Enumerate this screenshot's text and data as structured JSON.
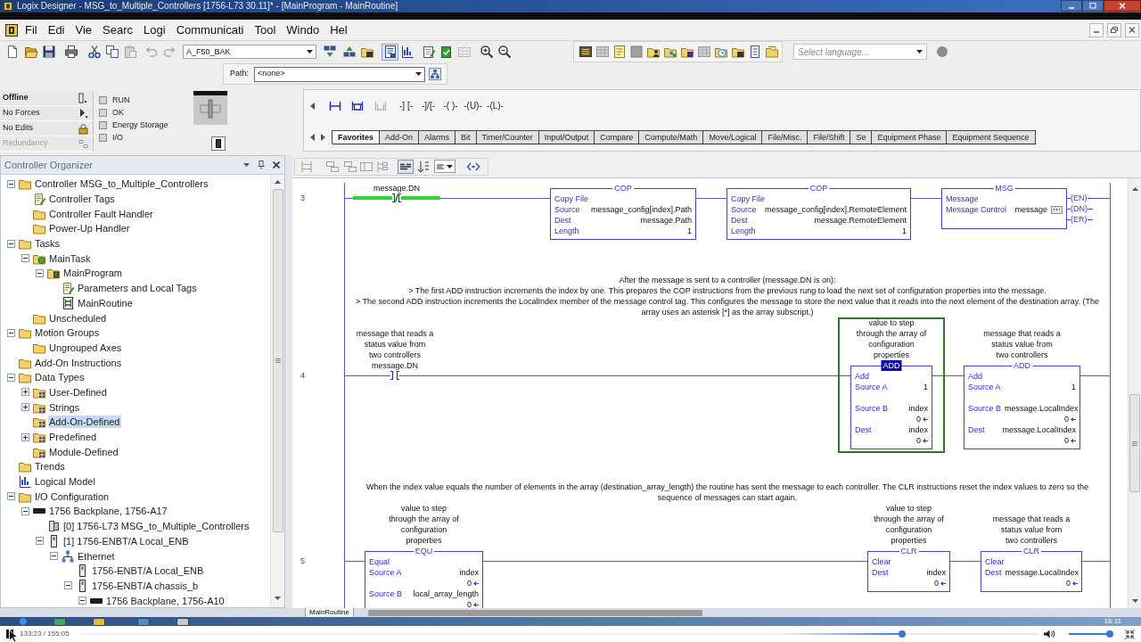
{
  "window": {
    "title": "Logix Designer - MSG_to_Multiple_Controllers [1756-L73 30.11]* - [MainProgram - MainRoutine]"
  },
  "menu": [
    "Fil",
    "Edi",
    "Vie",
    "Searc",
    "Logi",
    "Communicati",
    "Tool",
    "Windo",
    "Hel"
  ],
  "toolbar": {
    "recent_item": "A_F50_BAK",
    "language": {
      "placeholder": "Select language..."
    }
  },
  "path_bar": {
    "label": "Path:",
    "value": "<none>"
  },
  "controller_status": {
    "modes": [
      {
        "label": "Offline",
        "emphasized": true,
        "disabled": false
      },
      {
        "label": "No Forces",
        "emphasized": false,
        "disabled": false
      },
      {
        "label": "No Edits",
        "emphasized": false,
        "disabled": false
      },
      {
        "label": "Redundancy",
        "emphasized": false,
        "disabled": true
      }
    ],
    "indicators": [
      {
        "label": "RUN",
        "on": false
      },
      {
        "label": "OK",
        "on": false
      },
      {
        "label": "Energy Storage",
        "on": false
      },
      {
        "label": "I/O",
        "on": false
      }
    ]
  },
  "instruction_palette": {
    "symbols": [
      "-] [-",
      "-]/[-",
      "-( )-",
      "-(U)-",
      "-(L)-"
    ],
    "tabs": [
      {
        "label": "Favorites",
        "selected": true
      },
      {
        "label": "Add-On",
        "selected": false
      },
      {
        "label": "Alarms",
        "selected": false
      },
      {
        "label": "Bit",
        "selected": false
      },
      {
        "label": "Timer/Counter",
        "selected": false
      },
      {
        "label": "Input/Output",
        "selected": false
      },
      {
        "label": "Compare",
        "selected": false
      },
      {
        "label": "Compute/Math",
        "selected": false
      },
      {
        "label": "Move/Logical",
        "selected": false
      },
      {
        "label": "File/Misc.",
        "selected": false
      },
      {
        "label": "File/Shift",
        "selected": false
      },
      {
        "label": "Se",
        "selected": false
      },
      {
        "label": "Equipment Phase",
        "selected": false
      },
      {
        "label": "Equipment Sequence",
        "selected": false
      }
    ]
  },
  "controller_organizer": {
    "title": "Controller Organizer",
    "tree": [
      {
        "label": "Controller MSG_to_Multiple_Controllers",
        "kind": "folder",
        "expanded": true,
        "selected": false,
        "children": [
          {
            "label": "Controller Tags",
            "kind": "tags",
            "selected": false
          },
          {
            "label": "Controller Fault Handler",
            "kind": "folder",
            "selected": false
          },
          {
            "label": "Power-Up Handler",
            "kind": "folder",
            "selected": false
          }
        ]
      },
      {
        "label": "Tasks",
        "kind": "folder",
        "expanded": true,
        "selected": false,
        "children": [
          {
            "label": "MainTask",
            "kind": "task",
            "expanded": true,
            "selected": false,
            "children": [
              {
                "label": "MainProgram",
                "kind": "program",
                "expanded": true,
                "selected": false,
                "children": [
                  {
                    "label": "Parameters and Local Tags",
                    "kind": "tags",
                    "selected": false
                  },
                  {
                    "label": "MainRoutine",
                    "kind": "routine",
                    "selected": false
                  }
                ]
              }
            ]
          },
          {
            "label": "Unscheduled",
            "kind": "folder",
            "selected": false
          }
        ]
      },
      {
        "label": "Motion Groups",
        "kind": "folder",
        "expanded": true,
        "selected": false,
        "children": [
          {
            "label": "Ungrouped Axes",
            "kind": "folder",
            "selected": false
          }
        ]
      },
      {
        "label": "Add-On Instructions",
        "kind": "folder",
        "selected": false
      },
      {
        "label": "Data Types",
        "kind": "folder",
        "expanded": true,
        "selected": false,
        "children": [
          {
            "label": "User-Defined",
            "kind": "types",
            "expanded": false,
            "selected": false
          },
          {
            "label": "Strings",
            "kind": "types",
            "expanded": false,
            "selected": false
          },
          {
            "label": "Add-On-Defined",
            "kind": "types",
            "selected": true
          },
          {
            "label": "Predefined",
            "kind": "types",
            "expanded": false,
            "selected": false
          },
          {
            "label": "Module-Defined",
            "kind": "types",
            "selected": false
          }
        ]
      },
      {
        "label": "Trends",
        "kind": "folder",
        "selected": false
      },
      {
        "label": "Logical Model",
        "kind": "model",
        "selected": false
      },
      {
        "label": "I/O Configuration",
        "kind": "folder",
        "expanded": true,
        "selected": false,
        "children": [
          {
            "label": "1756 Backplane, 1756-A17",
            "kind": "backplane",
            "expanded": true,
            "selected": false,
            "children": [
              {
                "label": "[0] 1756-L73 MSG_to_Multiple_Controllers",
                "kind": "controller",
                "selected": false
              },
              {
                "label": "[1] 1756-ENBT/A Local_ENB",
                "kind": "module",
                "expanded": true,
                "selected": false,
                "children": [
                  {
                    "label": "Ethernet",
                    "kind": "network",
                    "expanded": true,
                    "selected": false,
                    "children": [
                      {
                        "label": "1756-ENBT/A Local_ENB",
                        "kind": "module",
                        "selected": false
                      },
                      {
                        "label": "1756-ENBT/A chassis_b",
                        "kind": "module",
                        "expanded": true,
                        "selected": false,
                        "children": [
                          {
                            "label": "1756 Backplane, 1756-A10",
                            "kind": "backplane",
                            "expanded": true,
                            "selected": false
                          }
                        ]
                      }
                    ]
                  }
                ]
              }
            ]
          }
        ]
      }
    ]
  },
  "ladder": {
    "rungs": [
      {
        "number": "3",
        "elements": [
          {
            "kind": "xio",
            "operand": "message.DN",
            "highlighted": true,
            "selected": false
          },
          {
            "kind": "box",
            "mnemonic": "COP",
            "title": "Copy File",
            "selected": false,
            "live_values": false,
            "params": [
              {
                "name": "Source",
                "value": "message_config[index].Path"
              },
              {
                "name": "Dest",
                "value": "message.Path"
              },
              {
                "name": "Length",
                "value": "1"
              }
            ]
          },
          {
            "kind": "box",
            "mnemonic": "COP",
            "title": "Copy File",
            "selected": false,
            "live_values": false,
            "params": [
              {
                "name": "Source",
                "value": "message_config[index].RemoteElement"
              },
              {
                "name": "Dest",
                "value": "message.RemoteElement"
              },
              {
                "name": "Length",
                "value": "1"
              }
            ]
          },
          {
            "kind": "message",
            "mnemonic": "MSG",
            "title": "Message",
            "selected": false,
            "live_values": false,
            "params": [
              {
                "name": "Message Control",
                "value": "message"
              }
            ],
            "outputs": [
              "(EN)",
              "(DN)",
              "(ER)"
            ]
          }
        ]
      },
      {
        "number": "4",
        "comment": [
          "After the message is sent to a controller (message.DN is on):",
          "> The first ADD instruction increments the index by one. This prepares the COP instructions from the previous rung to load the next set of configuration properties into the message.",
          "> The second ADD instruction increments the LocalIndex member of the message control tag. This configures the message to store the next value that it reads into the next element of the destination array. (The",
          "array uses an asterisk [*] as the array subscript.)"
        ],
        "elements": [
          {
            "kind": "xic",
            "description": [
              "message that reads a",
              "status value from",
              "two controllers"
            ],
            "operand": "message.DN",
            "highlighted": false,
            "selected": false
          },
          {
            "kind": "box",
            "mnemonic": "ADD",
            "title": "Add",
            "description": [
              "value to step",
              "through the array of",
              "configuration",
              "properties"
            ],
            "selected": true,
            "live_values": true,
            "params": [
              {
                "name": "Source A",
                "value": "1"
              },
              {
                "name": "Source B",
                "value": "index",
                "live": "0"
              },
              {
                "name": "Dest",
                "value": "index",
                "live": "0"
              }
            ]
          },
          {
            "kind": "box",
            "mnemonic": "ADD",
            "title": "Add",
            "description": [
              "message that reads a",
              "status value from",
              "two controllers"
            ],
            "selected": false,
            "live_values": true,
            "params": [
              {
                "name": "Source A",
                "value": "1"
              },
              {
                "name": "Source B",
                "value": "message.LocalIndex",
                "live": "0"
              },
              {
                "name": "Dest",
                "value": "message.LocalIndex",
                "live": "0"
              }
            ]
          }
        ]
      },
      {
        "number": "5",
        "comment": [
          "When the index value equals the number of elements in the array (destination_array_length) the routine has sent the message to each controller. The CLR instructions reset the index values to zero so the",
          "sequence of messages can start again."
        ],
        "elements": [
          {
            "kind": "box",
            "mnemonic": "EQU",
            "title": "Equal",
            "description": [
              "value to step",
              "through the array of",
              "configuration",
              "properties"
            ],
            "selected": false,
            "live_values": true,
            "params": [
              {
                "name": "Source A",
                "value": "index",
                "live": "0"
              },
              {
                "name": "Source B",
                "value": "local_array_length",
                "live": "0"
              }
            ]
          },
          {
            "kind": "box",
            "mnemonic": "CLR",
            "title": "Clear",
            "description": [
              "value to step",
              "through the array of",
              "configuration",
              "properties"
            ],
            "selected": false,
            "live_values": true,
            "params": [
              {
                "name": "Dest",
                "value": "index",
                "live": "0"
              }
            ]
          },
          {
            "kind": "box",
            "mnemonic": "CLR",
            "title": "Clear",
            "description": [
              "message that reads a",
              "status value from",
              "two controllers"
            ],
            "selected": false,
            "live_values": true,
            "params": [
              {
                "name": "Dest",
                "value": "message.LocalIndex",
                "live": "0"
              }
            ]
          }
        ]
      }
    ]
  },
  "routine_tab": {
    "label": "MainRoutine"
  },
  "taskbar": {
    "clock": "16:11"
  },
  "video_player": {
    "time": "133:23 / 155:05",
    "progress": {
      "level": 0.86
    },
    "volume": {
      "level": 0.95
    }
  }
}
